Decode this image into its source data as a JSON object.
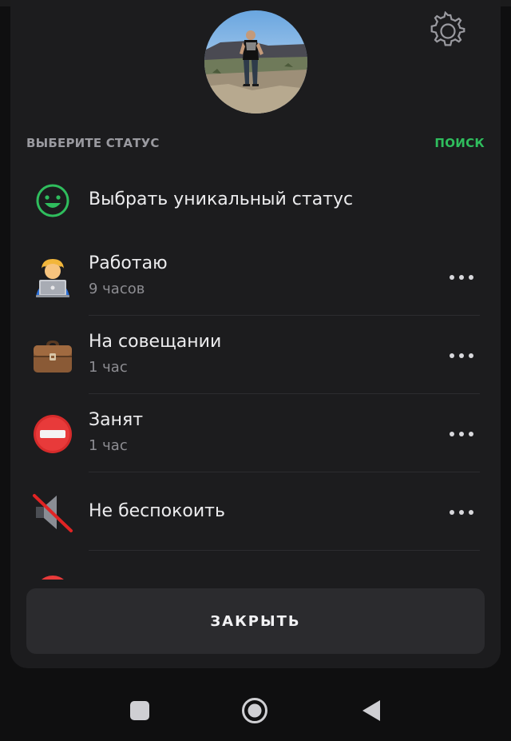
{
  "header": {
    "section_title": "ВЫБЕРИТЕ СТАТУС",
    "search_label": "ПОИСК"
  },
  "statuses": [
    {
      "name": "Выбрать уникальный статус",
      "duration": "",
      "icon": "smiley-icon"
    },
    {
      "name": "Работаю",
      "duration": "9 часов",
      "icon": "technologist-icon"
    },
    {
      "name": "На совещании",
      "duration": "1 час",
      "icon": "briefcase-icon"
    },
    {
      "name": "Занят",
      "duration": "1 час",
      "icon": "no-entry-icon"
    },
    {
      "name": "Не беспокоить",
      "duration": "",
      "icon": "muted-speaker-icon"
    }
  ],
  "footer": {
    "close_label": "ЗАКРЫТЬ"
  },
  "colors": {
    "accent": "#2fbd5d",
    "sheet_background": "#1c1c1e",
    "button_background": "#2b2b2e"
  }
}
